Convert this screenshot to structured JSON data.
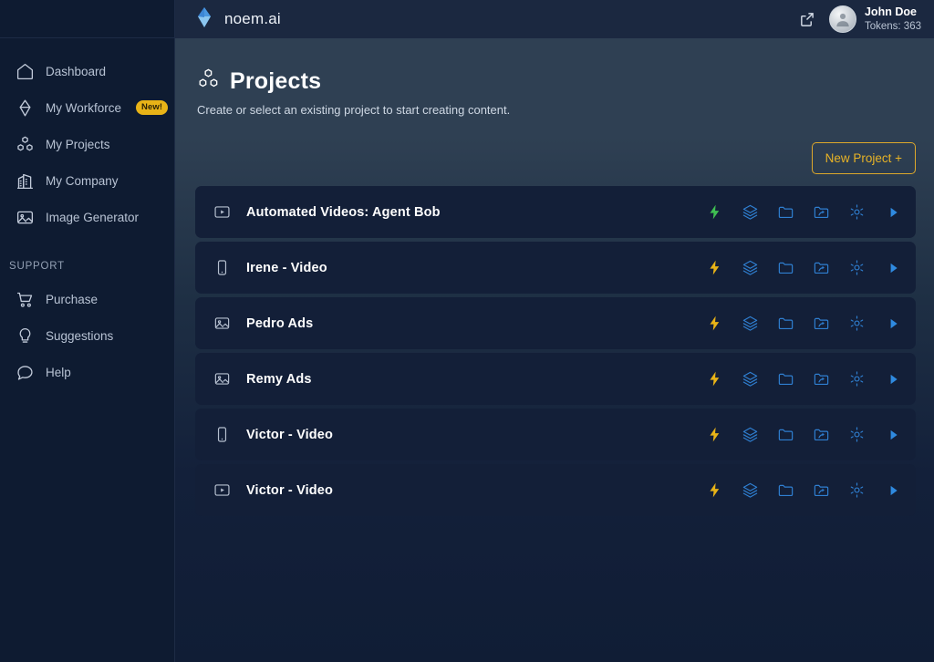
{
  "brand": {
    "name": "noem.ai",
    "logo_icon": "diamond-gem-icon",
    "logo_color": "#3b8fe0"
  },
  "header": {
    "external_link_icon": "external-link-icon",
    "avatar_icon": "user-avatar-icon",
    "user_name": "John Doe",
    "tokens_label": "Tokens: 363"
  },
  "sidebar": {
    "items": [
      {
        "label": "Dashboard",
        "icon": "home-icon",
        "badge": ""
      },
      {
        "label": "My Workforce",
        "icon": "diamond-gem-icon",
        "badge": "New!"
      },
      {
        "label": "My Projects",
        "icon": "boxes-icon",
        "badge": ""
      },
      {
        "label": "My Company",
        "icon": "building-icon",
        "badge": ""
      },
      {
        "label": "Image Generator",
        "icon": "image-icon",
        "badge": ""
      }
    ],
    "support_section_label": "SUPPORT",
    "support_items": [
      {
        "label": "Purchase",
        "icon": "shopping-cart-icon"
      },
      {
        "label": "Suggestions",
        "icon": "lightbulb-icon"
      },
      {
        "label": "Help",
        "icon": "chat-bubble-icon"
      }
    ]
  },
  "page": {
    "title": "Projects",
    "title_icon": "boxes-icon",
    "subtitle": "Create or select an existing project to start creating content.",
    "new_project_button": "New Project +",
    "new_project_accent": "#e8b326"
  },
  "projects": [
    {
      "title": "Automated Videos: Agent Bob",
      "type_icon": "video-box-icon",
      "actions": [
        {
          "name": "generate-bolt-icon",
          "icon": "bolt-icon",
          "color": "#3fbf52"
        },
        {
          "name": "layers-icon",
          "icon": "layers-icon",
          "color": "#2f7fd1"
        },
        {
          "name": "folder-icon",
          "icon": "folder-icon",
          "color": "#2f7fd1"
        },
        {
          "name": "folder-share-icon",
          "icon": "folder-share-icon",
          "color": "#2f7fd1"
        },
        {
          "name": "settings-gear-icon",
          "icon": "gear-icon",
          "color": "#2f7fd1"
        },
        {
          "name": "play-icon",
          "icon": "play-icon",
          "color": "#2f8ae0"
        }
      ],
      "highlighted": true
    },
    {
      "title": "Irene - Video",
      "type_icon": "smartphone-icon",
      "actions": [
        {
          "name": "generate-bolt-icon",
          "icon": "bolt-icon",
          "color": "#e8b317"
        },
        {
          "name": "layers-icon",
          "icon": "layers-icon",
          "color": "#2f7fd1"
        },
        {
          "name": "folder-icon",
          "icon": "folder-icon",
          "color": "#2f7fd1"
        },
        {
          "name": "folder-share-icon",
          "icon": "folder-share-icon",
          "color": "#2f7fd1"
        },
        {
          "name": "settings-gear-icon",
          "icon": "gear-icon",
          "color": "#2f7fd1"
        },
        {
          "name": "play-icon",
          "icon": "play-icon",
          "color": "#2f8ae0"
        }
      ],
      "highlighted": false
    },
    {
      "title": "Pedro Ads",
      "type_icon": "image-icon",
      "actions": [
        {
          "name": "generate-bolt-icon",
          "icon": "bolt-icon",
          "color": "#e8b317"
        },
        {
          "name": "layers-icon",
          "icon": "layers-icon",
          "color": "#2f7fd1"
        },
        {
          "name": "folder-icon",
          "icon": "folder-icon",
          "color": "#2f7fd1"
        },
        {
          "name": "folder-share-icon",
          "icon": "folder-share-icon",
          "color": "#2f7fd1"
        },
        {
          "name": "settings-gear-icon",
          "icon": "gear-icon",
          "color": "#2f7fd1"
        },
        {
          "name": "play-icon",
          "icon": "play-icon",
          "color": "#2f8ae0"
        }
      ],
      "highlighted": false
    },
    {
      "title": "Remy Ads",
      "type_icon": "image-icon",
      "actions": [
        {
          "name": "generate-bolt-icon",
          "icon": "bolt-icon",
          "color": "#e8b317"
        },
        {
          "name": "layers-icon",
          "icon": "layers-icon",
          "color": "#2f7fd1"
        },
        {
          "name": "folder-icon",
          "icon": "folder-icon",
          "color": "#2f7fd1"
        },
        {
          "name": "folder-share-icon",
          "icon": "folder-share-icon",
          "color": "#2f7fd1"
        },
        {
          "name": "settings-gear-icon",
          "icon": "gear-icon",
          "color": "#2f7fd1"
        },
        {
          "name": "play-icon",
          "icon": "play-icon",
          "color": "#2f8ae0"
        }
      ],
      "highlighted": false
    },
    {
      "title": "Victor - Video",
      "type_icon": "smartphone-icon",
      "actions": [
        {
          "name": "generate-bolt-icon",
          "icon": "bolt-icon",
          "color": "#e8b317"
        },
        {
          "name": "layers-icon",
          "icon": "layers-icon",
          "color": "#2f7fd1"
        },
        {
          "name": "folder-icon",
          "icon": "folder-icon",
          "color": "#2f7fd1"
        },
        {
          "name": "folder-share-icon",
          "icon": "folder-share-icon",
          "color": "#2f7fd1"
        },
        {
          "name": "settings-gear-icon",
          "icon": "gear-icon",
          "color": "#2f7fd1"
        },
        {
          "name": "play-icon",
          "icon": "play-icon",
          "color": "#2f8ae0"
        }
      ],
      "highlighted": false
    },
    {
      "title": "Victor - Video",
      "type_icon": "video-box-icon",
      "actions": [
        {
          "name": "generate-bolt-icon",
          "icon": "bolt-icon",
          "color": "#e8b317"
        },
        {
          "name": "layers-icon",
          "icon": "layers-icon",
          "color": "#2f7fd1"
        },
        {
          "name": "folder-icon",
          "icon": "folder-icon",
          "color": "#2f7fd1"
        },
        {
          "name": "folder-share-icon",
          "icon": "folder-share-icon",
          "color": "#2f7fd1"
        },
        {
          "name": "settings-gear-icon",
          "icon": "gear-icon",
          "color": "#2f7fd1"
        },
        {
          "name": "play-icon",
          "icon": "play-icon",
          "color": "#2f8ae0"
        }
      ],
      "highlighted": false
    }
  ],
  "annotation": {
    "shape": "circle",
    "color": "#e81d1d",
    "target": "play-icon-row-1"
  }
}
